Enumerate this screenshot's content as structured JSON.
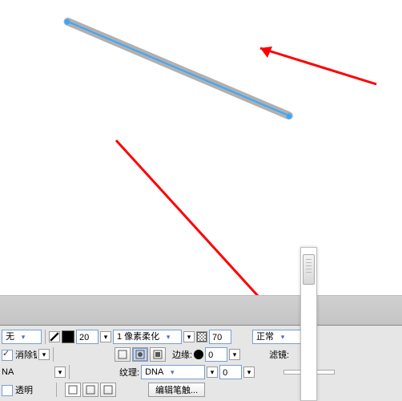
{
  "canvas": {
    "object": "rounded-bar",
    "endpoint_color": "#3aa7ff",
    "fill_color": "#b0b0b0"
  },
  "row1": {
    "fill_mode": "无",
    "stroke_color": "#000000",
    "stroke_width": "20",
    "edge_label": "1 像素柔化",
    "opacity": "70",
    "blend_mode": "正常"
  },
  "row2": {
    "antialias_label": "消除锯齿",
    "antialias_checked": true,
    "edge_word": "边缘:",
    "edge_shape_size": "0",
    "filters_label": "滤镜:"
  },
  "row3": {
    "dna_cut": "NA",
    "texture_label": "纹理:",
    "texture_value": "DNA",
    "texture_size": "0"
  },
  "row4": {
    "transparent_label": "透明",
    "transparent_checked": false,
    "edit_stroke_label": "编辑笔触..."
  }
}
